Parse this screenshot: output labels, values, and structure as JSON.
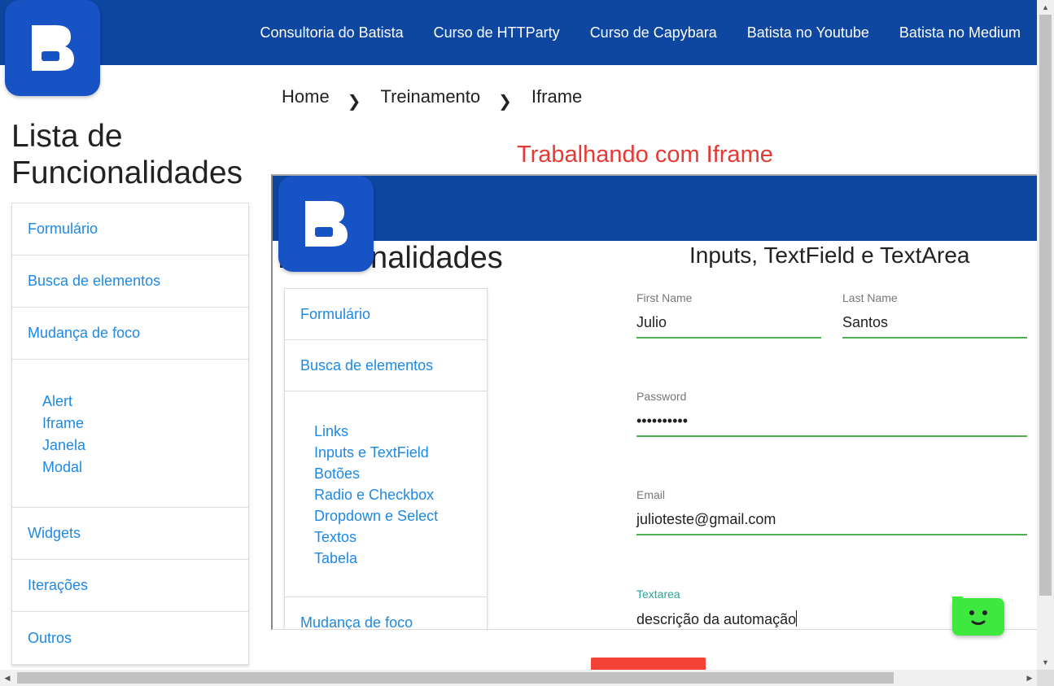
{
  "nav": {
    "links": [
      "Consultoria do Batista",
      "Curso de HTTParty",
      "Curso de Capybara",
      "Batista no Youtube",
      "Batista no Medium"
    ]
  },
  "logo": {
    "letter": "B"
  },
  "breadcrumb": {
    "home": "Home",
    "treinamento": "Treinamento",
    "current": "Iframe"
  },
  "sidebar": {
    "title_line1": "Lista de",
    "title_line2": "Funcionalidades",
    "formulario": "Formulário",
    "busca": "Busca de elementos",
    "mudanca": "Mudança de foco",
    "mudanca_items": [
      "Alert",
      "Iframe",
      "Janela",
      "Modal"
    ],
    "widgets": "Widgets",
    "iteracoes": "Iterações",
    "outros": "Outros"
  },
  "page": {
    "heading": "Trabalhando com Iframe"
  },
  "iframe": {
    "side_title": "Funcionalidades",
    "formulario": "Formulário",
    "busca": "Busca de elementos",
    "busca_items": [
      "Links",
      "Inputs e TextField",
      "Botões",
      "Radio e Checkbox",
      "Dropdown e Select",
      "Textos",
      "Tabela"
    ],
    "mudanca": "Mudança de foco",
    "form_title": "Inputs, TextField e TextArea",
    "first_name": {
      "label": "First Name",
      "value": "Julio"
    },
    "last_name": {
      "label": "Last Name",
      "value": "Santos"
    },
    "password": {
      "label": "Password",
      "value": "••••••••••"
    },
    "email": {
      "label": "Email",
      "value": "julioteste@gmail.com"
    },
    "textarea": {
      "label": "Textarea",
      "value": "descrição da automação"
    }
  },
  "colors": {
    "navbar": "#0d47a1",
    "link": "#1e88e5",
    "heading": "#e53935",
    "underline": "#4caf50",
    "bot": "#3ee83e"
  }
}
